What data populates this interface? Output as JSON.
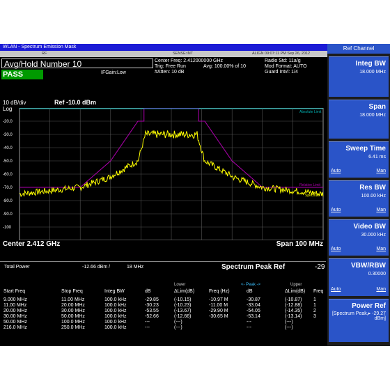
{
  "window": {
    "title": "WLAN - Spectrum Emission Mask",
    "status_left": "RF",
    "status_mid": "SENSE:INT",
    "status_right": "ALIGN 09:07:11 PM Sep 26, 2012"
  },
  "measurement": {
    "avg_hold": "Avg/Hold Number 10",
    "pass": "PASS",
    "center_freq": "Center Freq: 2.412000000 GHz",
    "trig": "Trig: Free Run",
    "atten": "#Atten: 10 dB",
    "if_gain": "IFGain:Low",
    "avg": "Avg: 100.00% of 10",
    "radio_std": "Radio Std: 11a/g",
    "mod_format": "Mod Format: AUTO",
    "guard_intvl": "Guard Intvl: 1/4"
  },
  "plot": {
    "scale": "10 dB/div",
    "ref": "Ref -10.0 dBm",
    "log": "Log",
    "y_ticks": [
      "-20.0",
      "-30.0",
      "-40.0",
      "-50.0",
      "-60.0",
      "-70.0",
      "-80.0",
      "-90.0",
      "-100"
    ],
    "center": "Center 2.412 GHz",
    "span": "Span 100 MHz",
    "labels": {
      "absolute_limit": "Absolute Limit",
      "relative_limit": "Relative Limit",
      "spectrum": "Spectrum"
    },
    "colors": {
      "trace": "#ffff00",
      "limit": "#b000b0",
      "abs_limit": "#00b0b0"
    }
  },
  "table": {
    "total_power_label": "Total Power",
    "total_power_value": "-12.66 dBm /",
    "total_power_bw": "18 MHz",
    "peak_ref_title": "Spectrum Peak Ref",
    "peak_ref_value": "-29",
    "headers": [
      "Start Freq",
      "Stop Freq",
      "Integ BW",
      "dB",
      "ΔLim(dB)",
      "Freq (Hz)",
      "dB",
      "ΔLim(dB)",
      "Freq"
    ],
    "lower_label": "Lower",
    "peak_label": "<- Peak ->",
    "upper_label": "Upper",
    "rows": [
      [
        "9.000 MHz",
        "11.00 MHz",
        "100.0 kHz",
        "-29.85",
        "(-10.15)",
        "-10.97 M",
        "-30.87",
        "(-10.87)",
        "1"
      ],
      [
        "11.00 MHz",
        "20.00 MHz",
        "100.0 kHz",
        "-30.23",
        "(-10.23)",
        "-11.00 M",
        "-33.04",
        "(-12.88)",
        "1"
      ],
      [
        "20.00 MHz",
        "30.00 MHz",
        "100.0 kHz",
        "-53.55",
        "(-13.67)",
        "-29.90 M",
        "-54.05",
        "(-14.35)",
        "2"
      ],
      [
        "30.00 MHz",
        "50.00 MHz",
        "100.0 kHz",
        "-52.66",
        "(-12.66)",
        "-30.65 M",
        "-53.14",
        "(-13.14)",
        "3"
      ],
      [
        "50.00 MHz",
        "100.0 MHz",
        "100.0 kHz",
        "---",
        "(---)",
        "",
        "---",
        "(---)",
        ""
      ],
      [
        "216.0 MHz",
        "250.0 MHz",
        "100.0 kHz",
        "---",
        "(---)",
        "",
        "---",
        "(---)",
        ""
      ]
    ]
  },
  "softkeys": {
    "header": "Ref Channel",
    "items": [
      {
        "title": "Integ BW",
        "value": "18.000 MHz",
        "auto": "",
        "man": ""
      },
      {
        "title": "Span",
        "value": "18.000 MHz",
        "auto": "",
        "man": ""
      },
      {
        "title": "Sweep Time",
        "value": "6.41 ms",
        "auto": "Auto",
        "man": "Man"
      },
      {
        "title": "Res BW",
        "value": "100.00 kHz",
        "auto": "Auto",
        "man": "Man"
      },
      {
        "title": "Video BW",
        "value": "30.000 kHz",
        "auto": "Auto",
        "man": "Man"
      },
      {
        "title": "VBW/RBW",
        "value": "0.30000",
        "auto": "Auto",
        "man": "Man"
      },
      {
        "title": "Power Ref",
        "value": "[Spectrum Peak,▸ -29.27 dBm]",
        "auto": "",
        "man": ""
      }
    ]
  }
}
